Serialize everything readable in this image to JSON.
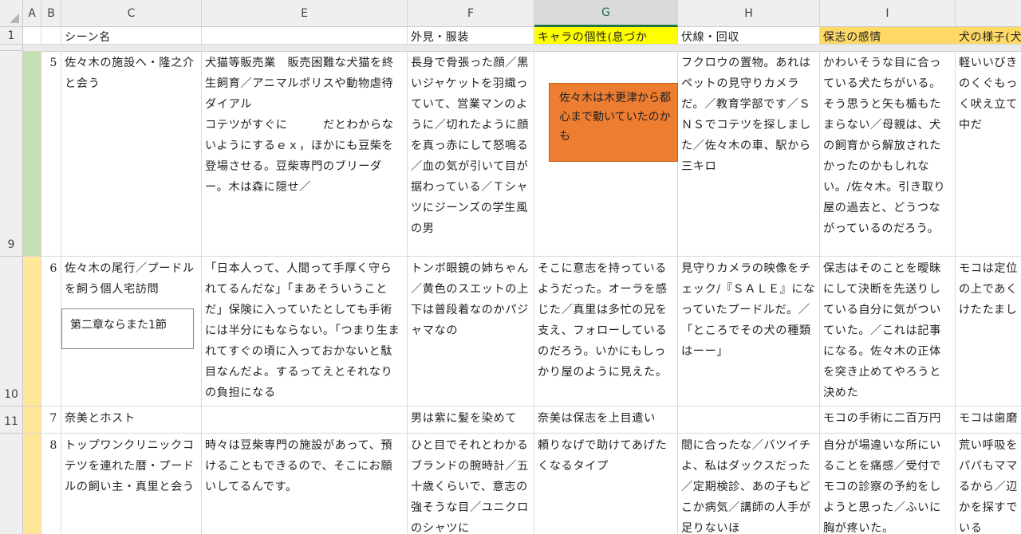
{
  "columns": [
    "A",
    "B",
    "C",
    "E",
    "F",
    "G",
    "H",
    "I",
    ""
  ],
  "row_headers": {
    "r1": "1",
    "r9": "9",
    "r10": "10",
    "r11": "11"
  },
  "header_row": {
    "C": "シーン名",
    "F": "外見・服装",
    "G": "キャラの個性(息づか",
    "H": "伏線・回収",
    "I": "保志の感情",
    "J": "犬の様子(犬"
  },
  "rows": [
    {
      "num": "5",
      "C": "佐々木の施設へ・隆之介と会う",
      "E": "犬猫等販売業　販売困難な犬猫を終生飼育／アニマルポリスや動物虐待ダイアル\nコテツがすぐに　　　だとわからないようにするｅｘ，ほかにも豆柴を登場させる。豆柴専門のブリーダー。木は森に隠せ／",
      "F": "長身で骨張った顔／黒いジャケットを羽織っていて、営業マンのように／切れたように顔を真っ赤にして怒鳴る／血の気が引いて目が据わっている／Ｔシャツにジーンズの学生風の男",
      "G": "",
      "H": "フクロウの置物。あれはペットの見守りカメラだ。／教育学部です／ＳＮＳでコテツを探しました／佐々木の車、駅から三キロ",
      "I": "かわいそうな目に合っている犬たちがいる。そう思うと矢も楯もたまらない／母親は、犬の飼育から解放されたかったのかもしれない。/佐々木。引き取り屋の過去と、どうつながっているのだろう。",
      "J": "軽いいびきのくぐもっく吠え立て中だ"
    },
    {
      "num": "6",
      "C": "佐々木の尾行／プードルを飼う個人宅訪問",
      "E": "「日本人って、人間って手厚く守られてるんだな」「まあそういうことだ」保険に入っていたとしても手術には半分にもならない。「つまり生まれてすぐの頃に入っておかないと駄目なんだよ。するってえとそれなりの負担になる",
      "F": "トンボ眼鏡の姉ちゃん／黄色のスエットの上下は普段着なのかパジャマなの",
      "G": "そこに意志を持っているようだった。オーラを感じた／真里は多忙の兄を支え、フォローしているのだろう。いかにもしっかり屋のように見えた。",
      "H": "見守りカメラの映像をチェック/『ＳＡＬＥ』になっていたプードルだ。／「ところでその犬の種類はーー」",
      "I": "保志はそのことを曖昧にして決断を先送りしている自分に気がついていた。／これは記事になる。佐々木の正体を突き止めてやろうと決めた",
      "J": "モコは定位の上であくけたたまし"
    },
    {
      "num": "7",
      "C": "奈美とホスト",
      "E": "",
      "F": "男は紫に髪を染めて",
      "G": "奈美は保志を上目遣い",
      "H": "",
      "I": "モコの手術に二百万円",
      "J": "モコは歯磨"
    },
    {
      "num": "8",
      "C": "トップワンクリニックコテツを連れた暦・プードルの飼い主・真里と会う",
      "E": "時々は豆柴専門の施設があって、預けることもできるので、そこにお願いしてるんです。",
      "F": "ひと目でそれとわかるブランドの腕時計／五十歳くらいで、意志の強そうな目／ユニクロのシャツに",
      "G": "頼りなげで助けてあげたくなるタイプ",
      "H": "間に合ったな／バツイチよ、私はダックスだった／定期検診、あの子もどこか病気／講師の人手が足りないほ",
      "I": "自分が場違いな所にいることを痛感／受付でモコの診察の予約をしようと思った／ふいに胸が疼いた。",
      "J": "荒い呼吸をパパもママるから／辺かを探すでいる"
    }
  ],
  "notes": {
    "orange": "佐々木は木更津から都心まで動いていたのかも",
    "white": "第二章ならまた1節"
  },
  "colors": {
    "yellow": "#ffff00",
    "gold": "#ffd966",
    "row9_band": "#c6e0b4",
    "row10_band": "#ffe699",
    "note_orange": "#ed7d31"
  }
}
